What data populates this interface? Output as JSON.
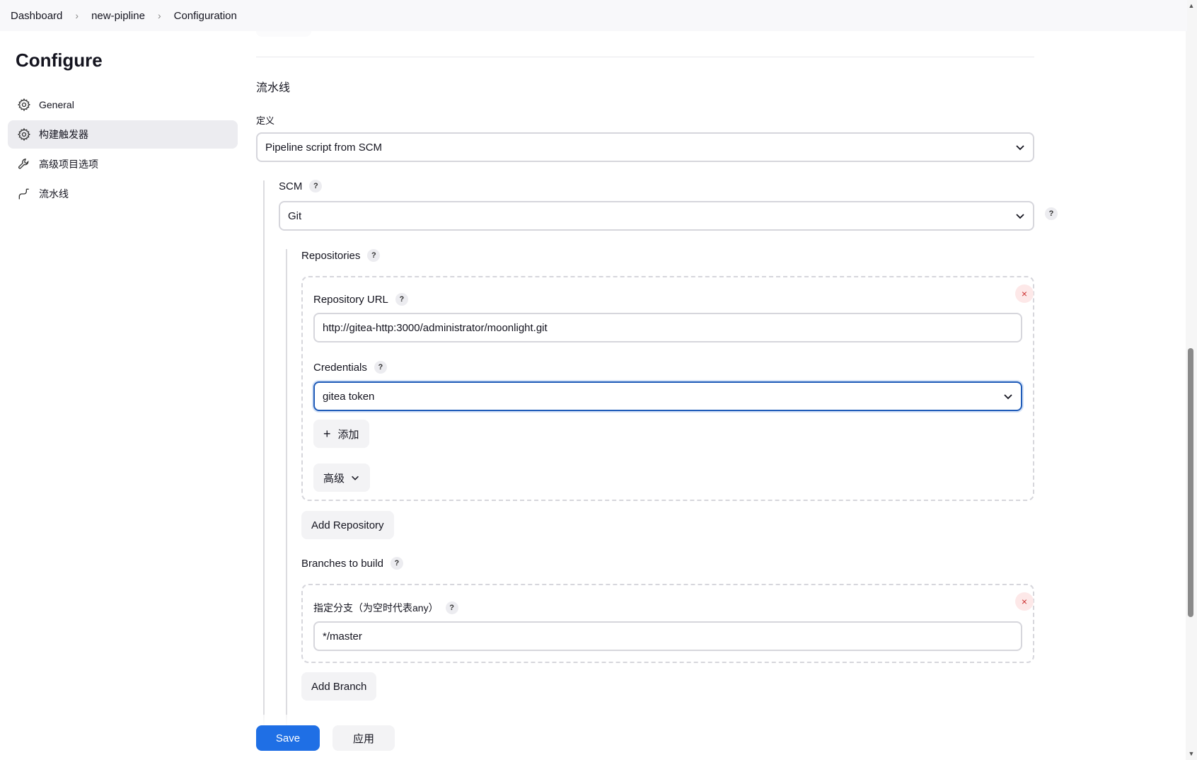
{
  "breadcrumb": [
    "Dashboard",
    "new-pipline",
    "Configuration"
  ],
  "page_title": "Configure",
  "sidebar": {
    "items": [
      {
        "label": "General",
        "icon": "gear-icon"
      },
      {
        "label": "构建触发器",
        "icon": "gear-icon"
      },
      {
        "label": "高级项目选项",
        "icon": "wrench-icon"
      },
      {
        "label": "流水线",
        "icon": "pipeline-icon"
      }
    ],
    "active_index": 1
  },
  "main": {
    "section_title": "流水线",
    "definition_label": "定义",
    "definition_value": "Pipeline script from SCM",
    "scm_label": "SCM",
    "scm_value": "Git",
    "repositories_label": "Repositories",
    "repo_url_label": "Repository URL",
    "repo_url_value": "http://gitea-http:3000/administrator/moonlight.git",
    "credentials_label": "Credentials",
    "credentials_value": "gitea token",
    "add_label": "添加",
    "advanced_label": "高级",
    "add_repository_label": "Add Repository",
    "branches_label": "Branches to build",
    "branch_specifier_label": "指定分支（为空时代表any）",
    "branch_value": "*/master",
    "add_branch_label": "Add Branch"
  },
  "footer": {
    "save_label": "Save",
    "apply_label": "应用"
  },
  "help_glyph": "?",
  "close_glyph": "×",
  "colors": {
    "accent": "#1f6fe5",
    "focus_border": "#1f5bb8",
    "active_nav_bg": "#ececf0"
  }
}
